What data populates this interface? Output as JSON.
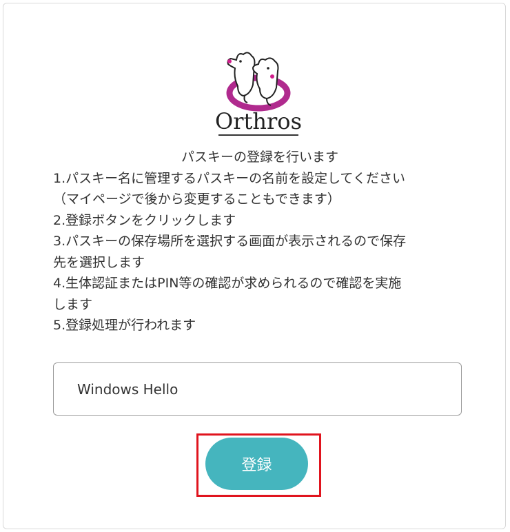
{
  "brand": {
    "logo_text": "Orthros",
    "accent_color": "#b02a8e"
  },
  "instructions": {
    "title": "パスキーの登録を行います",
    "lines": [
      "1.パスキー名に管理するパスキーの名前を設定してください",
      "（マイページで後から変更することもできます）",
      "2.登録ボタンをクリックします",
      "3.パスキーの保存場所を選択する画面が表示されるので保存",
      "先を選択します",
      "4.生体認証またはPIN等の確認が求められるので確認を実施",
      "します",
      "5.登録処理が行われます"
    ]
  },
  "form": {
    "passkey_name_value": "Windows Hello",
    "register_label": "登録",
    "button_color": "#45b5be",
    "highlight_color": "#e0141e"
  }
}
